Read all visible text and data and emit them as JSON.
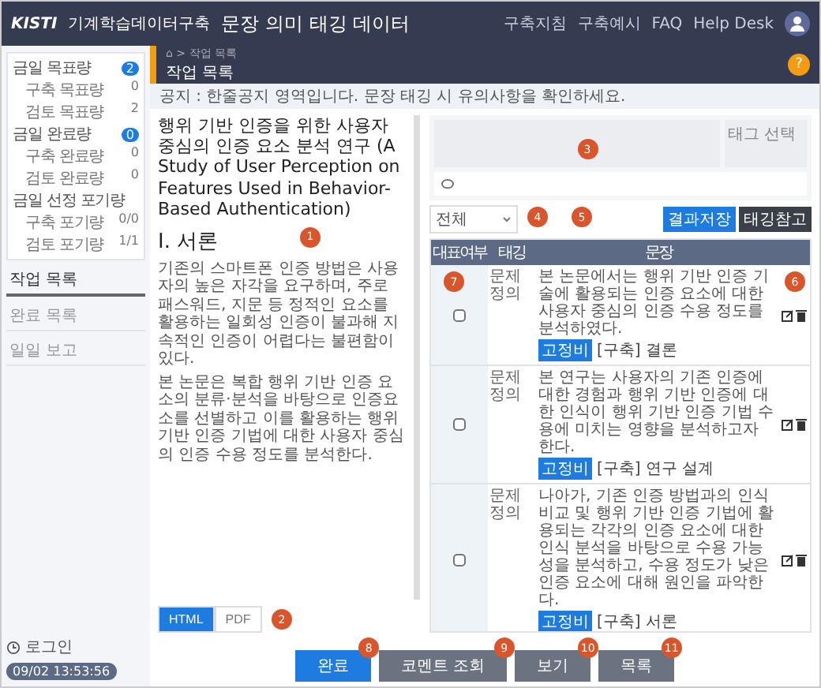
{
  "header": {
    "logo_mark": "KISTI",
    "logo_text": "기계학습데이터구축",
    "title": "문장 의미 태깅 데이터",
    "links": [
      "구축지침",
      "구축예시",
      "FAQ",
      "Help Desk"
    ]
  },
  "subheader": {
    "breadcrumb": "⌂ > 작업 목록",
    "title": "작업 목록",
    "help": "?"
  },
  "notice": "공지 : 한줄공지 영역입니다. 문장 태깅 시 유의사항을 확인하세요.",
  "sidebar": {
    "groups": [
      {
        "title": "금일 목표량",
        "badge": "2",
        "items": [
          {
            "label": "구축 목표량",
            "value": "0"
          },
          {
            "label": "검토 목표량",
            "value": "2"
          }
        ]
      },
      {
        "title": "금일 완료량",
        "badge": "0",
        "items": [
          {
            "label": "구축 완료량",
            "value": "0"
          },
          {
            "label": "검토 완료량",
            "value": "0"
          }
        ]
      },
      {
        "title": "금일 선정 포기량",
        "items": [
          {
            "label": "구축 포기량",
            "value": "0/0"
          },
          {
            "label": "검토 포기량",
            "value": "1/1"
          }
        ]
      }
    ],
    "menu": [
      {
        "label": "작업 목록",
        "selected": true
      },
      {
        "label": "완료 목록",
        "selected": false
      },
      {
        "label": "일일 보고",
        "selected": false
      }
    ],
    "login_label": "로그인",
    "login_time": "09/02 13:53:56"
  },
  "document": {
    "title": "행위 기반 인증을 위한 사용자 중심의 인증 요소 분석 연구 (A Study of User Perception on Features Used in Behavior-Based Authentication)",
    "heading": "I. 서론",
    "paragraphs": [
      "기존의 스마트폰 인증 방법은 사용자의 높은 자각을 요구하며, 주로 패스워드, 지문 등 정적인 요소를 활용하는 일회성 인증이 불과해 지속적인 인증이 어렵다는 불편함이 있다.",
      "본 논문은 복합 행위 기반 인증 요소의 분류·분석을 바탕으로 인증요소를 선별하고 이를 활용하는 행위 기반 인증 기법에 대한 사용자 중심의 인증 수용 정도를 분석한다."
    ],
    "formats": [
      {
        "label": "HTML",
        "selected": true
      },
      {
        "label": "PDF",
        "selected": false
      }
    ]
  },
  "editor": {
    "tag_select": "태그 선택",
    "buttons": [
      "결과저장",
      "태깅참고"
    ]
  },
  "filter": "전체",
  "table": {
    "columns": [
      "대표여부",
      "태깅",
      "문장"
    ],
    "rows": [
      {
        "checked": false,
        "category": "문제 정의",
        "sentence": "본 논문에서는 행위 기반 인증 기술에 활용되는 인증 요소에 대한 사용자 중심의 인증 수용 정도를 분석하였다.",
        "badge": "고정비",
        "label": "[구축] 결론"
      },
      {
        "checked": false,
        "category": "문제 정의",
        "sentence": "본 연구는 사용자의 기존 인증에 대한 경험과 행위 기반 인증에 대한 인식이 행위 기반 인증 기법 수용에 미치는 영향을 분석하고자 한다.",
        "badge": "고정비",
        "label": "[구축] 연구 설계"
      },
      {
        "checked": false,
        "category": "문제 정의",
        "sentence": "나아가, 기존 인증 방법과의 인식 비교 및 행위 기반 인증 기법에 활용되는 각각의 인증 요소에 대한 인식 분석을 바탕으로 수용 가능성을 분석하고, 수용 정도가 낮은 인증 요소에 대해 원인을 파악한다.",
        "badge": "고정비",
        "label": "[구축] 서론"
      }
    ]
  },
  "actions": [
    {
      "label": "완료",
      "kind": "primary"
    },
    {
      "label": "코멘트 조회",
      "kind": "secondary"
    },
    {
      "label": "보기",
      "kind": "secondary"
    },
    {
      "label": "목록",
      "kind": "secondary"
    }
  ],
  "markers": [
    "1",
    "2",
    "3",
    "4",
    "5",
    "6",
    "7",
    "8",
    "9",
    "10",
    "11"
  ]
}
